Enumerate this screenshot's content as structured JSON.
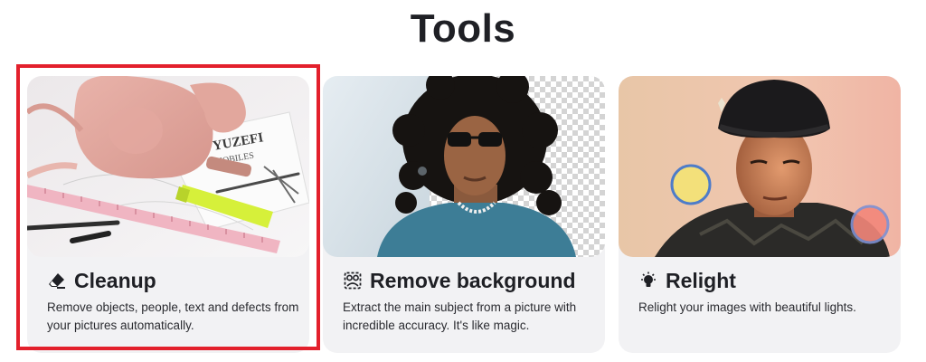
{
  "page": {
    "title": "Tools"
  },
  "accent": {
    "selection_outline": "#e3202c",
    "card_background": "#f2f2f4"
  },
  "tools": [
    {
      "icon": "eraser-icon",
      "title": "Cleanup",
      "description": "Remove objects, people, text and defects from your pictures automatically."
    },
    {
      "icon": "remove-background-icon",
      "title": "Remove background",
      "description": "Extract the main subject from a picture with incredible accuracy. It's like magic."
    },
    {
      "icon": "lightbulb-icon",
      "title": "Relight",
      "description": "Relight your images with beautiful lights."
    }
  ]
}
